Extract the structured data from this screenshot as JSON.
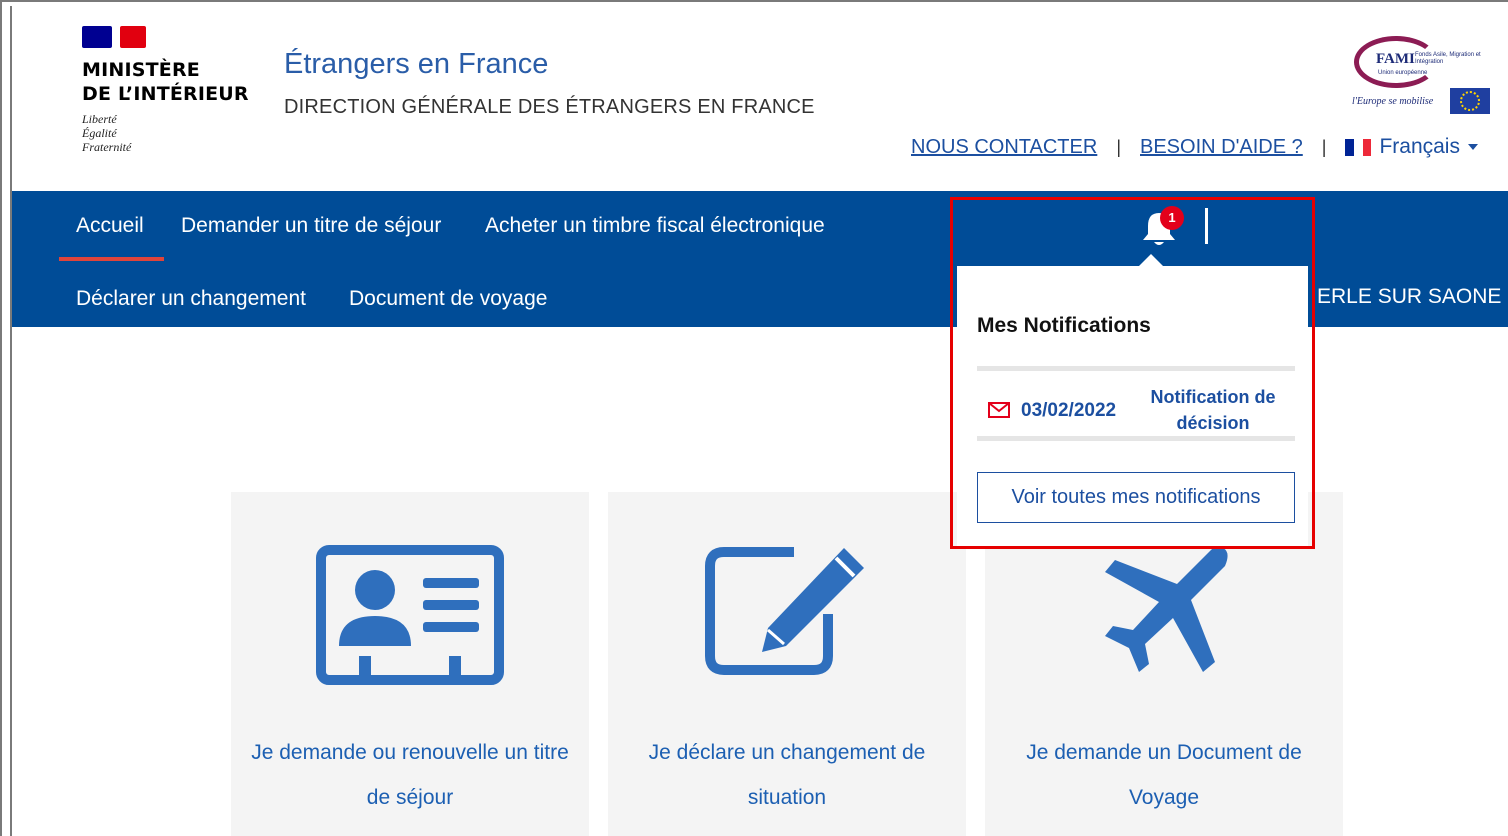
{
  "header": {
    "ministry_line1": "MINISTÈRE",
    "ministry_line2": "DE L’INTÉRIEUR",
    "motto_1": "Liberté",
    "motto_2": "Égalité",
    "motto_3": "Fraternité",
    "site_title": "Étrangers en France",
    "site_subtitle": "DIRECTION GÉNÉRALE DES ÉTRANGERS EN FRANCE",
    "fami_logo": "FAMI",
    "fami_logo_sub": "Fonds Asile, Migration et Intégration",
    "fami_logo_ue": "Union européenne",
    "fami_motto": "l'Europe se mobilise",
    "contact_link": "NOUS CONTACTER",
    "help_link": "BESOIN D'AIDE ?",
    "separator": "|",
    "language": "Français",
    "flag_colors": [
      "#002395",
      "#ffffff",
      "#ed2939"
    ]
  },
  "nav": {
    "items": [
      {
        "label": "Accueil"
      },
      {
        "label": "Demander un titre de séjour"
      },
      {
        "label": "Acheter un timbre fiscal électronique"
      },
      {
        "label": "Déclarer un changement"
      },
      {
        "label": "Document de voyage"
      }
    ],
    "user_location_partial": "ERLE SUR SAONE"
  },
  "notifications": {
    "badge_count": "1",
    "title": "Mes Notifications",
    "items": [
      {
        "date": "03/02/2022",
        "type": "Notification de décision",
        "icon": "mail-icon"
      }
    ],
    "view_all_label": "Voir toutes mes notifications"
  },
  "cards": [
    {
      "icon": "id-card-icon",
      "label_line1": "Je demande ou renouvelle un titre",
      "label_line2": "de séjour"
    },
    {
      "icon": "edit-icon",
      "label_line1": "Je déclare un changement de",
      "label_line2": "situation"
    },
    {
      "icon": "airplane-icon",
      "label_line1": "Je demande un Document de",
      "label_line2": "Voyage"
    }
  ],
  "colors": {
    "navbar": "#004c97",
    "accent_red": "#e0443a",
    "link_blue": "#1c4fa0",
    "card_icon_blue": "#2f6fbd",
    "highlight_border": "#e60000"
  }
}
